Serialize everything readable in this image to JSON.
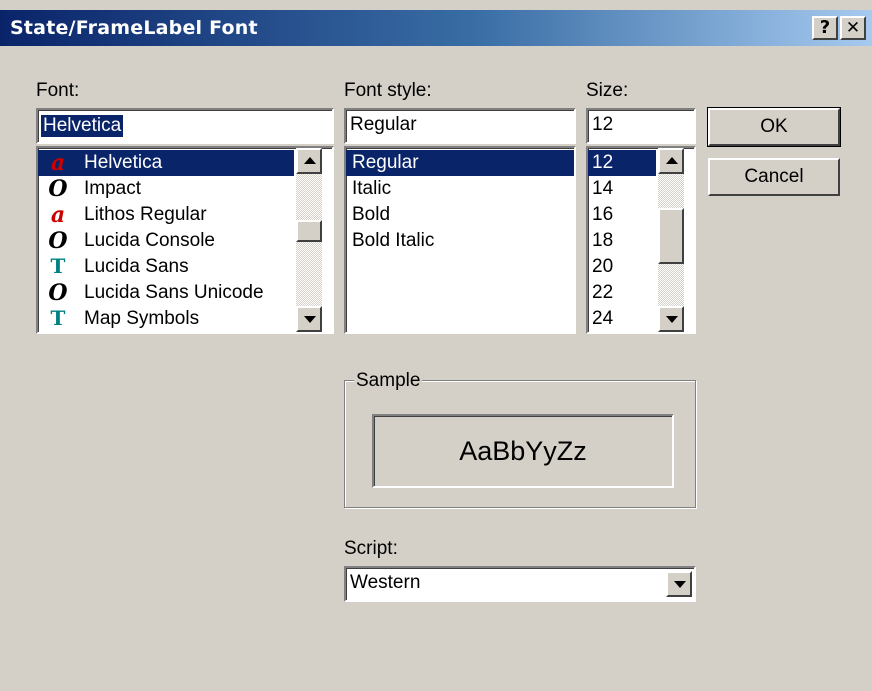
{
  "window": {
    "title": "State/FrameLabel Font",
    "help_label": "?",
    "close_label": "✕"
  },
  "font": {
    "label": "Font:",
    "value": "Helvetica",
    "items": [
      {
        "label": "Helvetica",
        "icon": "a",
        "icon_type": "type1-icon",
        "color": "#cc0000"
      },
      {
        "label": "Impact",
        "icon": "O",
        "icon_type": "opentype-icon",
        "color": "#000000"
      },
      {
        "label": "Lithos Regular",
        "icon": "a",
        "icon_type": "type1-icon",
        "color": "#cc0000"
      },
      {
        "label": "Lucida Console",
        "icon": "O",
        "icon_type": "opentype-icon",
        "color": "#000000"
      },
      {
        "label": "Lucida Sans",
        "icon": "T",
        "icon_type": "truetype-icon",
        "color": "#008080"
      },
      {
        "label": "Lucida Sans Unicode",
        "icon": "O",
        "icon_type": "opentype-icon",
        "color": "#000000"
      },
      {
        "label": "Map Symbols",
        "icon": "T",
        "icon_type": "truetype-icon",
        "color": "#008080"
      }
    ]
  },
  "style": {
    "label": "Font style:",
    "value": "Regular",
    "items": [
      "Regular",
      "Italic",
      "Bold",
      "Bold Italic"
    ]
  },
  "size": {
    "label": "Size:",
    "value": "12",
    "items": [
      "12",
      "14",
      "16",
      "18",
      "20",
      "22",
      "24"
    ]
  },
  "buttons": {
    "ok": "OK",
    "cancel": "Cancel"
  },
  "sample": {
    "label": "Sample",
    "text": "AaBbYyZz"
  },
  "script": {
    "label": "Script:",
    "value": "Western"
  },
  "colors": {
    "titlebar_start": "#0a246a",
    "titlebar_end": "#a6caf0",
    "selection": "#0a246a",
    "face": "#d4d0c8"
  }
}
